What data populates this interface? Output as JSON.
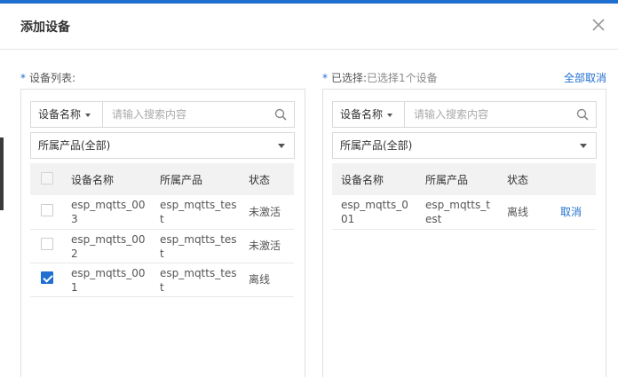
{
  "dialog": {
    "title": "添加设备"
  },
  "left": {
    "required_mark": "*",
    "label": "设备列表:",
    "search": {
      "field_label": "设备名称",
      "placeholder": "请输入搜索内容"
    },
    "product_filter": "所属产品(全部)",
    "columns": [
      "设备名称",
      "所属产品",
      "状态"
    ],
    "rows": [
      {
        "name": "esp_mqtts_003",
        "product": "esp_mqtts_test",
        "status": "未激活",
        "checked": false
      },
      {
        "name": "esp_mqtts_002",
        "product": "esp_mqtts_test",
        "status": "未激活",
        "checked": false
      },
      {
        "name": "esp_mqtts_001",
        "product": "esp_mqtts_test",
        "status": "离线",
        "checked": true
      }
    ]
  },
  "right": {
    "required_mark": "*",
    "label": "已选择:",
    "selection_info": "已选择1个设备",
    "clear_all": "全部取消",
    "search": {
      "field_label": "设备名称",
      "placeholder": "请输入搜索内容"
    },
    "product_filter": "所属产品(全部)",
    "columns": [
      "设备名称",
      "所属产品",
      "状态"
    ],
    "rows": [
      {
        "name": "esp_mqtts_001",
        "product": "esp_mqtts_test",
        "status": "离线",
        "action": "取消"
      }
    ]
  },
  "colors": {
    "accent": "#1f6fd0",
    "header_bg": "#f2f2f2"
  }
}
